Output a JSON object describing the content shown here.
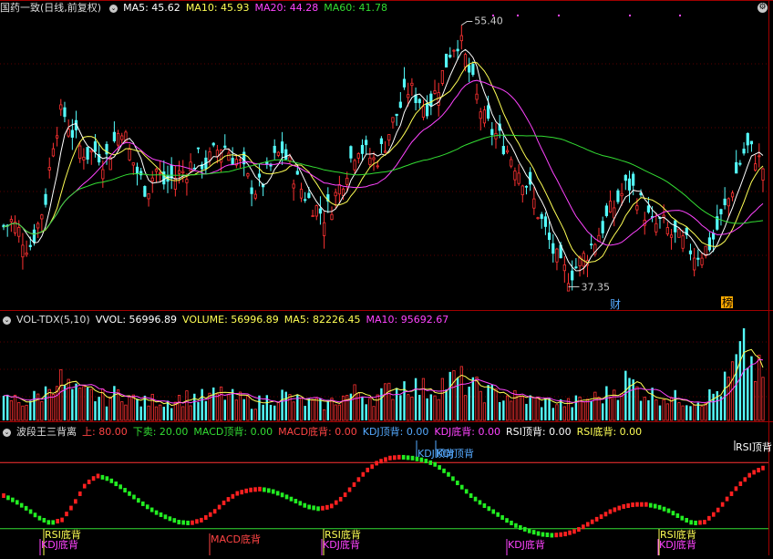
{
  "main": {
    "stock_name": "国药一致",
    "period_label": "(日线,前复权)",
    "indicators": [
      {
        "label": "MA5: 45.62",
        "color": "#ffffff"
      },
      {
        "label": "MA10: 45.93",
        "color": "#ffff55"
      },
      {
        "label": "MA20: 44.28",
        "color": "#ff44ff"
      },
      {
        "label": "MA60: 41.78",
        "color": "#33dd33"
      }
    ],
    "high_label": "55.40",
    "low_label": "37.35",
    "marker_cai": "财",
    "marker_bang": "榜"
  },
  "vol": {
    "name": "VOL-TDX(5,10)",
    "indicators": [
      {
        "label": "VVOL: 56996.89",
        "color": "#ffffff"
      },
      {
        "label": "VOLUME: 56996.89",
        "color": "#ffff55"
      },
      {
        "label": "MA5: 82226.45",
        "color": "#ffff55"
      },
      {
        "label": "MA10: 95692.67",
        "color": "#ff44ff"
      }
    ]
  },
  "osc": {
    "name": "波段王三背离",
    "indicators": [
      {
        "label": "上: 80.00",
        "color": "#ff4444"
      },
      {
        "label": "下卖: 20.00",
        "color": "#33dd33"
      },
      {
        "label": "MACD顶背: 0.00",
        "color": "#33dd33"
      },
      {
        "label": "MACD底背: 0.00",
        "color": "#ff4444"
      },
      {
        "label": "KDJ顶背: 0.00",
        "color": "#55aaff"
      },
      {
        "label": "KDJ底背: 0.00",
        "color": "#ff44ff"
      },
      {
        "label": "RSI顶背: 0.00",
        "color": "#ffffff"
      },
      {
        "label": "RSI底背: 0.00",
        "color": "#ffff55"
      }
    ],
    "signals": [
      {
        "text": "RSI底背",
        "color": "#ffff55"
      },
      {
        "text": "KDJ底背",
        "color": "#ff44ff"
      },
      {
        "text": "MACD底背",
        "color": "#ff4444"
      },
      {
        "text": "RSI底背",
        "color": "#ffff55"
      },
      {
        "text": "KDJ底背",
        "color": "#ff44ff"
      },
      {
        "text": "KDJ顶背",
        "color": "#55aaff"
      },
      {
        "text": "KDJ顶背",
        "color": "#55aaff"
      },
      {
        "text": "KDJ底背",
        "color": "#ff44ff"
      },
      {
        "text": "RSI底背",
        "color": "#ffff55"
      },
      {
        "text": "KDJ底背",
        "color": "#ff44ff"
      },
      {
        "text": "RSI顶背",
        "color": "#ffffff"
      }
    ]
  },
  "chart_data": [
    {
      "type": "candlestick",
      "title": "国药一致 (日线,前复权)",
      "price_range": [
        36,
        56
      ],
      "max_high": 55.4,
      "min_low": 37.35,
      "close_path": [
        41.5,
        41.9,
        41.0,
        40.0,
        41.5,
        43.5,
        48.0,
        49.5,
        48.2,
        47.0,
        46.5,
        46.8,
        46.0,
        47.2,
        48.5,
        46.5,
        45.0,
        44.0,
        45.5,
        44.5,
        44.8,
        45.2,
        45.6,
        46.2,
        45.8,
        46.6,
        47.2,
        46.5,
        45.8,
        44.6,
        44.0,
        44.8,
        46.0,
        46.8,
        45.6,
        44.4,
        43.5,
        42.8,
        42.3,
        43.2,
        44.5,
        46.0,
        47.2,
        46.5,
        46.0,
        47.0,
        48.5,
        49.8,
        51.0,
        50.5,
        49.8,
        50.5,
        52.0,
        53.8,
        54.5,
        52.5,
        50.5,
        48.8,
        48.0,
        47.5,
        46.5,
        45.5,
        44.5,
        43.0,
        41.5,
        40.0,
        38.6,
        38.2,
        38.8,
        39.6,
        40.5,
        41.5,
        42.6,
        43.5,
        44.5,
        43.8,
        42.5,
        41.5,
        41.8,
        41.0,
        40.6,
        40.2,
        39.6,
        39.8,
        40.5,
        42.0,
        43.5,
        45.5,
        47.0,
        46.5,
        45.6
      ]
    },
    {
      "type": "line",
      "series": [
        {
          "name": "MA5",
          "color": "#ffffff",
          "last": 45.62
        },
        {
          "name": "MA10",
          "color": "#ffff55",
          "last": 45.93
        },
        {
          "name": "MA20",
          "color": "#ff44ff",
          "last": 44.28
        },
        {
          "name": "MA60",
          "color": "#33dd33",
          "last": 41.78
        }
      ]
    },
    {
      "type": "bar",
      "title": "VOL-TDX(5,10)",
      "vol_path": [
        30,
        35,
        28,
        32,
        38,
        45,
        70,
        60,
        48,
        40,
        42,
        38,
        35,
        40,
        45,
        35,
        30,
        28,
        33,
        30,
        32,
        35,
        36,
        38,
        34,
        40,
        42,
        36,
        33,
        30,
        28,
        32,
        38,
        40,
        35,
        30,
        28,
        26,
        25,
        30,
        35,
        40,
        45,
        38,
        36,
        42,
        50,
        55,
        60,
        52,
        48,
        50,
        58,
        62,
        65,
        55,
        50,
        45,
        42,
        40,
        38,
        35,
        33,
        32,
        30,
        28,
        27,
        26,
        30,
        32,
        35,
        38,
        45,
        55,
        65,
        50,
        45,
        40,
        38,
        36,
        34,
        33,
        32,
        35,
        40,
        50,
        65,
        95,
        110,
        80,
        70
      ],
      "series": [
        {
          "name": "VOLUME",
          "last": 56996.89
        },
        {
          "name": "MA5",
          "last": 82226.45
        },
        {
          "name": "MA10",
          "last": 95692.67
        }
      ]
    },
    {
      "type": "dots",
      "title": "波段王三背离",
      "upper": 80,
      "lower": 20,
      "osc_path": [
        50,
        45,
        38,
        30,
        25,
        28,
        42,
        60,
        68,
        65,
        58,
        50,
        42,
        35,
        30,
        26,
        25,
        28,
        35,
        45,
        52,
        55,
        56,
        54,
        50,
        45,
        40,
        38,
        40,
        48,
        60,
        72,
        80,
        84,
        85,
        84,
        82,
        78,
        70,
        60,
        50,
        42,
        35,
        28,
        22,
        18,
        15,
        14,
        15,
        18,
        24,
        30,
        36,
        40,
        42,
        42,
        40,
        36,
        30,
        25,
        26,
        35,
        48,
        60,
        70,
        75
      ]
    }
  ]
}
